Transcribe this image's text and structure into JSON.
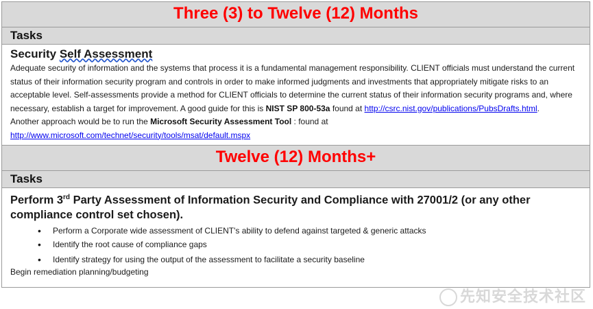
{
  "section1": {
    "title": "Three (3) to Twelve (12) Months",
    "tasks_label": "Tasks",
    "subtitle_a": "Security ",
    "subtitle_b": "Self Assessment",
    "para_1": "Adequate security of information and the systems that process it is a fundamental management responsibility. CLIENT officials must understand the current status of their information security program and controls in order to make informed judgments and investments that appropriately mitigate risks to an acceptable level. Self-assessments provide a method for CLIENT officials to determine the current status of their information security programs and, where necessary, establish a target for improvement. A good guide for this is ",
    "nist_bold": "NIST SP 800-53a",
    "found_at_1": " found at ",
    "link_1": "http://csrc.nist.gov/publications/PubsDrafts.html",
    "para_1_end": ".",
    "another_approach": "Another approach would be to run the ",
    "ms_bold": "Microsoft Security Assessment Tool",
    "found_at_2": " : found at",
    "link_2": "http://www.microsoft.com/technet/security/tools/msat/default.mspx"
  },
  "section2": {
    "title": "Twelve (12) Months+",
    "tasks_label": "Tasks",
    "perform_a": "Perform 3",
    "perform_sup": "rd",
    "perform_b": " Party Assessment of Information Security and Compliance with 27001/2 (or any other compliance control set chosen).",
    "bullets": [
      "Perform a Corporate wide assessment of CLIENT's ability to defend against targeted & generic attacks",
      "Identify the root cause of compliance gaps",
      "Identify strategy for using the output of the assessment to facilitate a security baseline"
    ],
    "closing": "Begin remediation planning/budgeting"
  },
  "watermark": {
    "text": "先知安全技术社区"
  }
}
